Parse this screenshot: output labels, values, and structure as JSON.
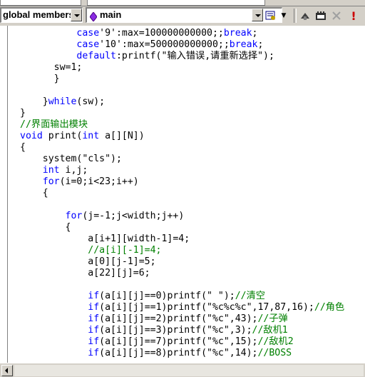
{
  "toolbar": {
    "class_combo": "global members",
    "function_combo": "main",
    "function_icon": "diamond-icon",
    "colors": {
      "face": "#d4d0c8",
      "stop_red": "#cc0000"
    }
  },
  "editor": {
    "colors": {
      "keyword": "#0000ff",
      "comment": "#008000",
      "text": "#000000"
    },
    "lines": [
      [
        {
          "t": "          "
        },
        {
          "t": "case",
          "c": "kw"
        },
        {
          "t": "'9':max=100000000000;;"
        },
        {
          "t": "break",
          "c": "kw"
        },
        {
          "t": ";"
        }
      ],
      [
        {
          "t": "          "
        },
        {
          "t": "case",
          "c": "kw"
        },
        {
          "t": "'10':max=500000000000;;"
        },
        {
          "t": "break",
          "c": "kw"
        },
        {
          "t": ";"
        }
      ],
      [
        {
          "t": "          "
        },
        {
          "t": "default",
          "c": "kw"
        },
        {
          "t": ":printf(\"输入错误,请重新选择\");"
        }
      ],
      [
        {
          "t": "      sw=1;"
        }
      ],
      [
        {
          "t": "      }"
        }
      ],
      [
        {
          "t": ""
        }
      ],
      [
        {
          "t": "    }"
        },
        {
          "t": "while",
          "c": "kw"
        },
        {
          "t": "(sw);"
        }
      ],
      [
        {
          "t": "}"
        }
      ],
      [
        {
          "t": "//界面输出模块",
          "c": "cm"
        }
      ],
      [
        {
          "t": "void",
          "c": "kw"
        },
        {
          "t": " print("
        },
        {
          "t": "int",
          "c": "kw"
        },
        {
          "t": " a[][N])"
        }
      ],
      [
        {
          "t": "{"
        }
      ],
      [
        {
          "t": "    system(\"cls\");"
        }
      ],
      [
        {
          "t": "    "
        },
        {
          "t": "int",
          "c": "kw"
        },
        {
          "t": " i,j;"
        }
      ],
      [
        {
          "t": "    "
        },
        {
          "t": "for",
          "c": "kw"
        },
        {
          "t": "(i=0;i<23;i++)"
        }
      ],
      [
        {
          "t": "    {"
        }
      ],
      [
        {
          "t": ""
        }
      ],
      [
        {
          "t": "        "
        },
        {
          "t": "for",
          "c": "kw"
        },
        {
          "t": "(j=-1;j<width;j++)"
        }
      ],
      [
        {
          "t": "        {"
        }
      ],
      [
        {
          "t": "            a[i+1][width-1]=4;"
        }
      ],
      [
        {
          "t": "            "
        },
        {
          "t": "//a[i][-1]=4;",
          "c": "cm"
        }
      ],
      [
        {
          "t": "            a[0][j-1]=5;"
        }
      ],
      [
        {
          "t": "            a[22][j]=6;"
        }
      ],
      [
        {
          "t": ""
        }
      ],
      [
        {
          "t": "            "
        },
        {
          "t": "if",
          "c": "kw"
        },
        {
          "t": "(a[i][j]==0)printf(\" \");"
        },
        {
          "t": "//清空",
          "c": "cm"
        }
      ],
      [
        {
          "t": "            "
        },
        {
          "t": "if",
          "c": "kw"
        },
        {
          "t": "(a[i][j]==1)printf(\"%c%c%c\",17,87,16);"
        },
        {
          "t": "//角色",
          "c": "cm"
        }
      ],
      [
        {
          "t": "            "
        },
        {
          "t": "if",
          "c": "kw"
        },
        {
          "t": "(a[i][j]==2)printf(\"%c\",43);"
        },
        {
          "t": "//子弹",
          "c": "cm"
        }
      ],
      [
        {
          "t": "            "
        },
        {
          "t": "if",
          "c": "kw"
        },
        {
          "t": "(a[i][j]==3)printf(\"%c\",3);"
        },
        {
          "t": "//敌机1",
          "c": "cm"
        }
      ],
      [
        {
          "t": "            "
        },
        {
          "t": "if",
          "c": "kw"
        },
        {
          "t": "(a[i][j]==7)printf(\"%c\",15);"
        },
        {
          "t": "//敌机2",
          "c": "cm"
        }
      ],
      [
        {
          "t": "            "
        },
        {
          "t": "if",
          "c": "kw"
        },
        {
          "t": "(a[i][j]==8)printf(\"%c\",14);"
        },
        {
          "t": "//BOSS",
          "c": "cm"
        }
      ]
    ]
  }
}
